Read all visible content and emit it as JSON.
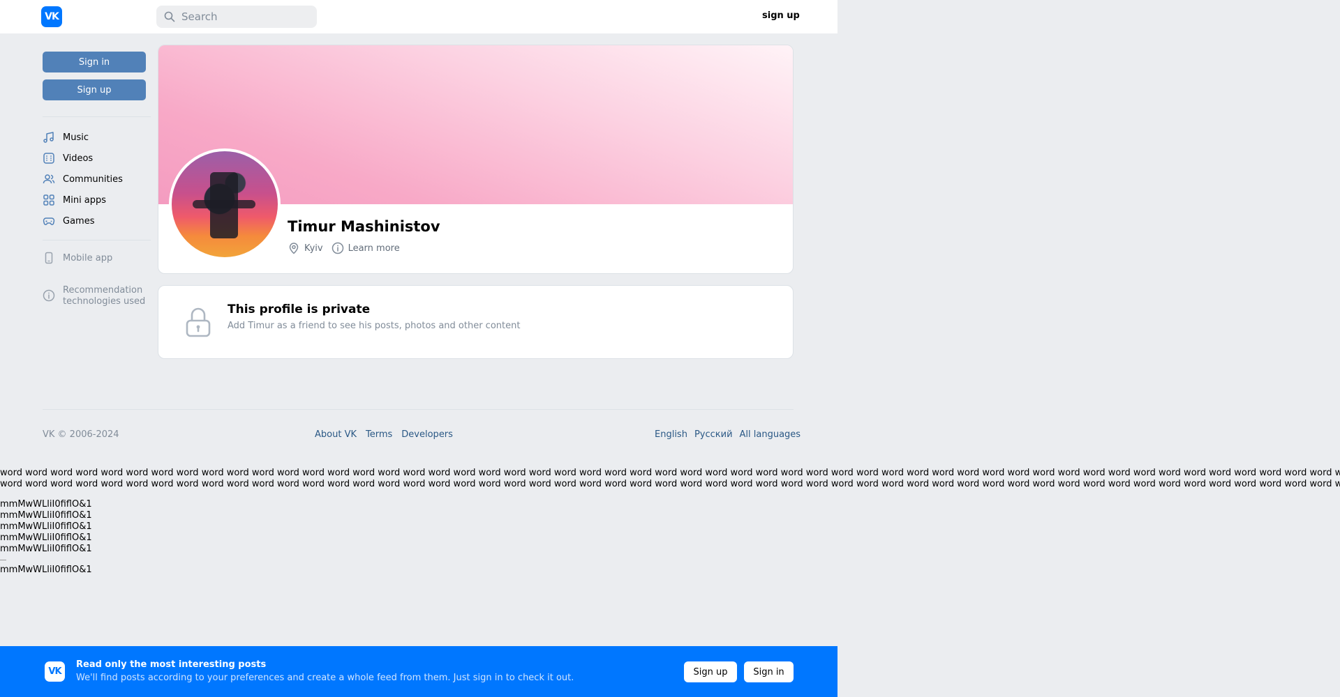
{
  "header": {
    "logo_text": "VK",
    "search_placeholder": "Search",
    "signup_label": "sign up"
  },
  "sidebar": {
    "signin_label": "Sign in",
    "signup_label": "Sign up",
    "items": [
      {
        "label": "Music",
        "icon": "music-icon"
      },
      {
        "label": "Videos",
        "icon": "video-icon"
      },
      {
        "label": "Communities",
        "icon": "users-icon"
      },
      {
        "label": "Mini apps",
        "icon": "apps-icon"
      },
      {
        "label": "Games",
        "icon": "gamepad-icon"
      }
    ],
    "mobile_app": "Mobile app",
    "recommendation_line1": "Recommendation",
    "recommendation_line2": "technologies used"
  },
  "profile": {
    "name": "Timur Mashinistov",
    "city": "Kyiv",
    "learn_more": "Learn more"
  },
  "private": {
    "title": "This profile is private",
    "subtitle": "Add Timur as a friend to see his posts, photos and other content"
  },
  "footer": {
    "copyright": "VK © 2006-2024",
    "links": [
      "About VK",
      "Terms",
      "Developers"
    ],
    "languages": [
      "English",
      "Русский",
      "All languages"
    ]
  },
  "test_text": {
    "words_line": "word word word word word word word word word word word word word word word word word word word word word word word word word word word word word word word word word word word word word word word word word word word word word word word word word word word word word word word word word word word",
    "glyphs": "mmMwWLliI0fiflO&1"
  },
  "banner": {
    "logo_text": "VK",
    "title": "Read only the most interesting posts",
    "subtitle": "We'll find posts according to your preferences and create a whole feed from them. Just sign in to check it out.",
    "signup_label": "Sign up",
    "signin_label": "Sign in"
  },
  "colors": {
    "accent": "#0077ff",
    "button_blue": "#5181b8",
    "link": "#2a5885",
    "muted": "#818c99"
  }
}
